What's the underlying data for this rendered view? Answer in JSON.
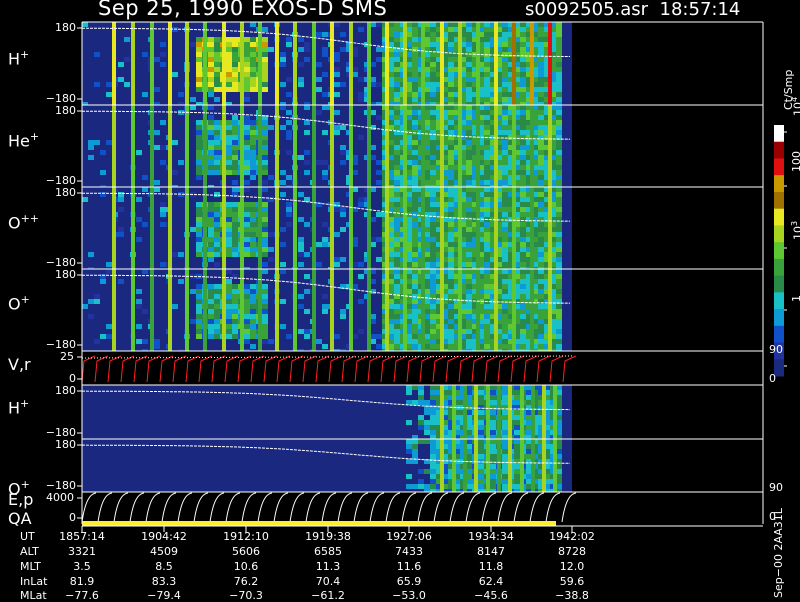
{
  "header": {
    "title": "Sep 25, 1990   EXOS-D SMS",
    "file": "s0092505.asr",
    "time": "18:57:14"
  },
  "colorbar": {
    "label": "Ct/Smp",
    "ticks": [
      "10",
      "100",
      "10",
      "1"
    ],
    "ticks_sup": [
      "4",
      "",
      "3",
      ""
    ],
    "tick_values": [
      10000,
      100,
      10,
      1
    ]
  },
  "panels": [
    {
      "label": "H",
      "sup": "+",
      "ytop": "180",
      "ybot": "−180"
    },
    {
      "label": "He",
      "sup": "+",
      "ytop": "180",
      "ybot": "−180"
    },
    {
      "label": "O",
      "sup": "++",
      "ytop": "180",
      "ybot": "−180"
    },
    {
      "label": "O",
      "sup": "+",
      "ytop": "180",
      "ybot": "−180"
    },
    {
      "label": "V,r",
      "sup": "",
      "ytop": "25",
      "ybot": "0",
      "rtop": "90",
      "rbot": "0"
    },
    {
      "label": "H",
      "sup": "+",
      "ytop": "180",
      "ybot": "−180"
    },
    {
      "label": "O",
      "sup": "+",
      "ytop": "180",
      "ybot": "−180"
    },
    {
      "label": "E,p",
      "sup": "",
      "ytop": "4000",
      "ybot": "0",
      "rtop": "90",
      "rbot": "0"
    }
  ],
  "qa_label": "QA",
  "time_table": {
    "rows": [
      {
        "label": "UT",
        "values": [
          "1857:14",
          "1904:42",
          "1912:10",
          "1919:38",
          "1927:06",
          "1934:34",
          "1942:02"
        ]
      },
      {
        "label": "ALT",
        "values": [
          "3321",
          "4509",
          "5606",
          "6585",
          "7433",
          "8147",
          "8728"
        ]
      },
      {
        "label": "MLT",
        "values": [
          "3.5",
          "8.5",
          "10.6",
          "11.3",
          "11.6",
          "11.8",
          "12.0"
        ]
      },
      {
        "label": "InLat",
        "values": [
          "81.9",
          "83.3",
          "76.2",
          "70.4",
          "65.9",
          "62.4",
          "59.6"
        ]
      },
      {
        "label": "MLat",
        "values": [
          "−77.6",
          "−79.4",
          "−70.3",
          "−61.2",
          "−53.0",
          "−45.6",
          "−38.8"
        ]
      }
    ]
  },
  "footer": "Sep−00  2AA31L",
  "chart_data": {
    "type": "heatmap",
    "title": "Sep 25, 1990   EXOS-D SMS",
    "x": [
      "1857:14",
      "1904:42",
      "1912:10",
      "1919:38",
      "1927:06",
      "1934:34",
      "1942:02"
    ],
    "xlabel": "UT",
    "scale": "log",
    "colorbar_range": [
      1,
      10000
    ],
    "colorbar_label": "Ct/Smp",
    "series": [
      {
        "name": "H+",
        "ylim": [
          -180,
          180
        ]
      },
      {
        "name": "He+",
        "ylim": [
          -180,
          180
        ]
      },
      {
        "name": "O++",
        "ylim": [
          -180,
          180
        ]
      },
      {
        "name": "O+",
        "ylim": [
          -180,
          180
        ]
      },
      {
        "name": "V,r",
        "ylim": [
          0,
          25
        ],
        "right_ylim": [
          0,
          90
        ]
      },
      {
        "name": "H+",
        "ylim": [
          -180,
          180
        ]
      },
      {
        "name": "O+",
        "ylim": [
          -180,
          180
        ]
      },
      {
        "name": "E,p",
        "ylim": [
          0,
          4000
        ],
        "right_ylim": [
          0,
          90
        ]
      }
    ]
  }
}
